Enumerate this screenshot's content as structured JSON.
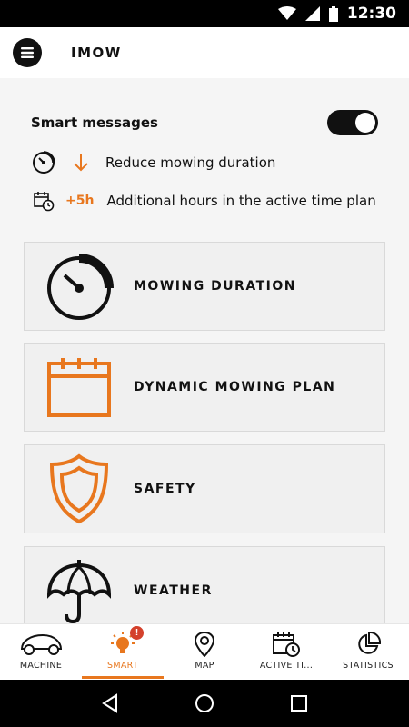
{
  "status_bar": {
    "time": "12:30"
  },
  "header": {
    "title": "IMOW"
  },
  "smart": {
    "title": "Smart messages",
    "toggle_on": true,
    "messages": [
      {
        "icon": "timer-icon",
        "indicator": "arrow-down-icon",
        "text": "Reduce mowing duration"
      },
      {
        "icon": "calendar-clock-icon",
        "indicator": "+5h",
        "text": "Additional hours in the active time plan"
      }
    ]
  },
  "cards": [
    {
      "icon": "timer-icon",
      "label": "MOWING DURATION"
    },
    {
      "icon": "calendar-icon",
      "label": "DYNAMIC MOWING PLAN"
    },
    {
      "icon": "shield-icon",
      "label": "SAFETY"
    },
    {
      "icon": "umbrella-icon",
      "label": "WEATHER"
    }
  ],
  "bottom_nav": [
    {
      "icon": "mower-icon",
      "label": "MACHINE"
    },
    {
      "icon": "lightbulb-icon",
      "label": "SMART",
      "active": true,
      "badge": "!"
    },
    {
      "icon": "map-pin-icon",
      "label": "MAP"
    },
    {
      "icon": "calendar-clock-icon",
      "label": "ACTIVE TI..."
    },
    {
      "icon": "pie-chart-icon",
      "label": "STATISTICS"
    }
  ],
  "colors": {
    "accent": "#e8771e",
    "badge": "#d4412c",
    "dark": "#111111"
  }
}
